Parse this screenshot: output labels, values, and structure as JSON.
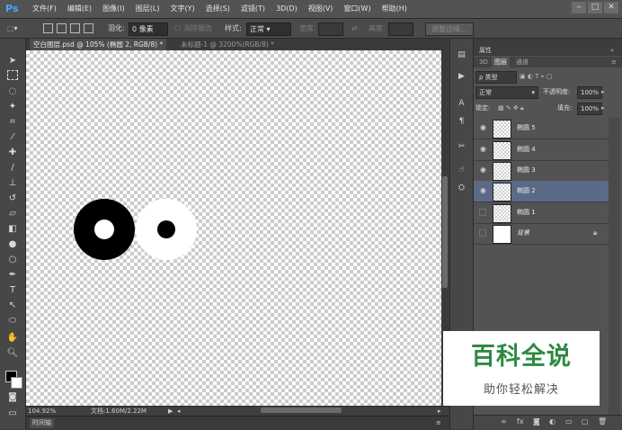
{
  "app": {
    "logo": "Ps"
  },
  "menu": [
    "文件(F)",
    "编辑(E)",
    "图像(I)",
    "图层(L)",
    "文字(Y)",
    "选择(S)",
    "滤镜(T)",
    "3D(D)",
    "视图(V)",
    "窗口(W)",
    "帮助(H)"
  ],
  "window_controls": [
    "‒",
    "□",
    "✕"
  ],
  "options": {
    "feather_label": "羽化:",
    "feather_value": "0 像素",
    "antialias_label": "消除锯齿",
    "style_label": "样式:",
    "style_value": "正常",
    "width_label": "宽度:",
    "height_label": "高度:",
    "refine_edge": "调整边缘..."
  },
  "tabs": [
    "空白图层.psd @ 105% (椭圆 2, RGB/8) *",
    "未标题-1 @ 3200%(RGB/8) *"
  ],
  "status": {
    "zoom": "104.92%",
    "doc": "文档:1.60M/2.22M"
  },
  "timeline_label": "时间轴",
  "panel": {
    "header": "属性",
    "tabs": [
      "3D",
      "图层",
      "通道"
    ],
    "active_tab_index": 1,
    "filter_label": "ρ 类型",
    "blend_mode": "正常",
    "opacity_label": "不透明度:",
    "opacity_value": "100%",
    "lock_label": "锁定:",
    "fill_label": "填充:",
    "fill_value": "100%"
  },
  "layers": [
    {
      "name": "椭圆 5",
      "visible": true,
      "selected": false,
      "background": false
    },
    {
      "name": "椭圆 4",
      "visible": true,
      "selected": false,
      "background": false
    },
    {
      "name": "椭圆 3",
      "visible": true,
      "selected": false,
      "background": false
    },
    {
      "name": "椭圆 2",
      "visible": true,
      "selected": true,
      "background": false
    },
    {
      "name": "椭圆 1",
      "visible": false,
      "selected": false,
      "background": false
    },
    {
      "name": "背景",
      "visible": false,
      "selected": false,
      "background": true
    }
  ],
  "watermark": {
    "title": "百科全说",
    "subtitle": "助你轻松解决"
  },
  "colors": {
    "accent_selected": "#5b6a86",
    "watermark_green": "#2d8a43"
  }
}
